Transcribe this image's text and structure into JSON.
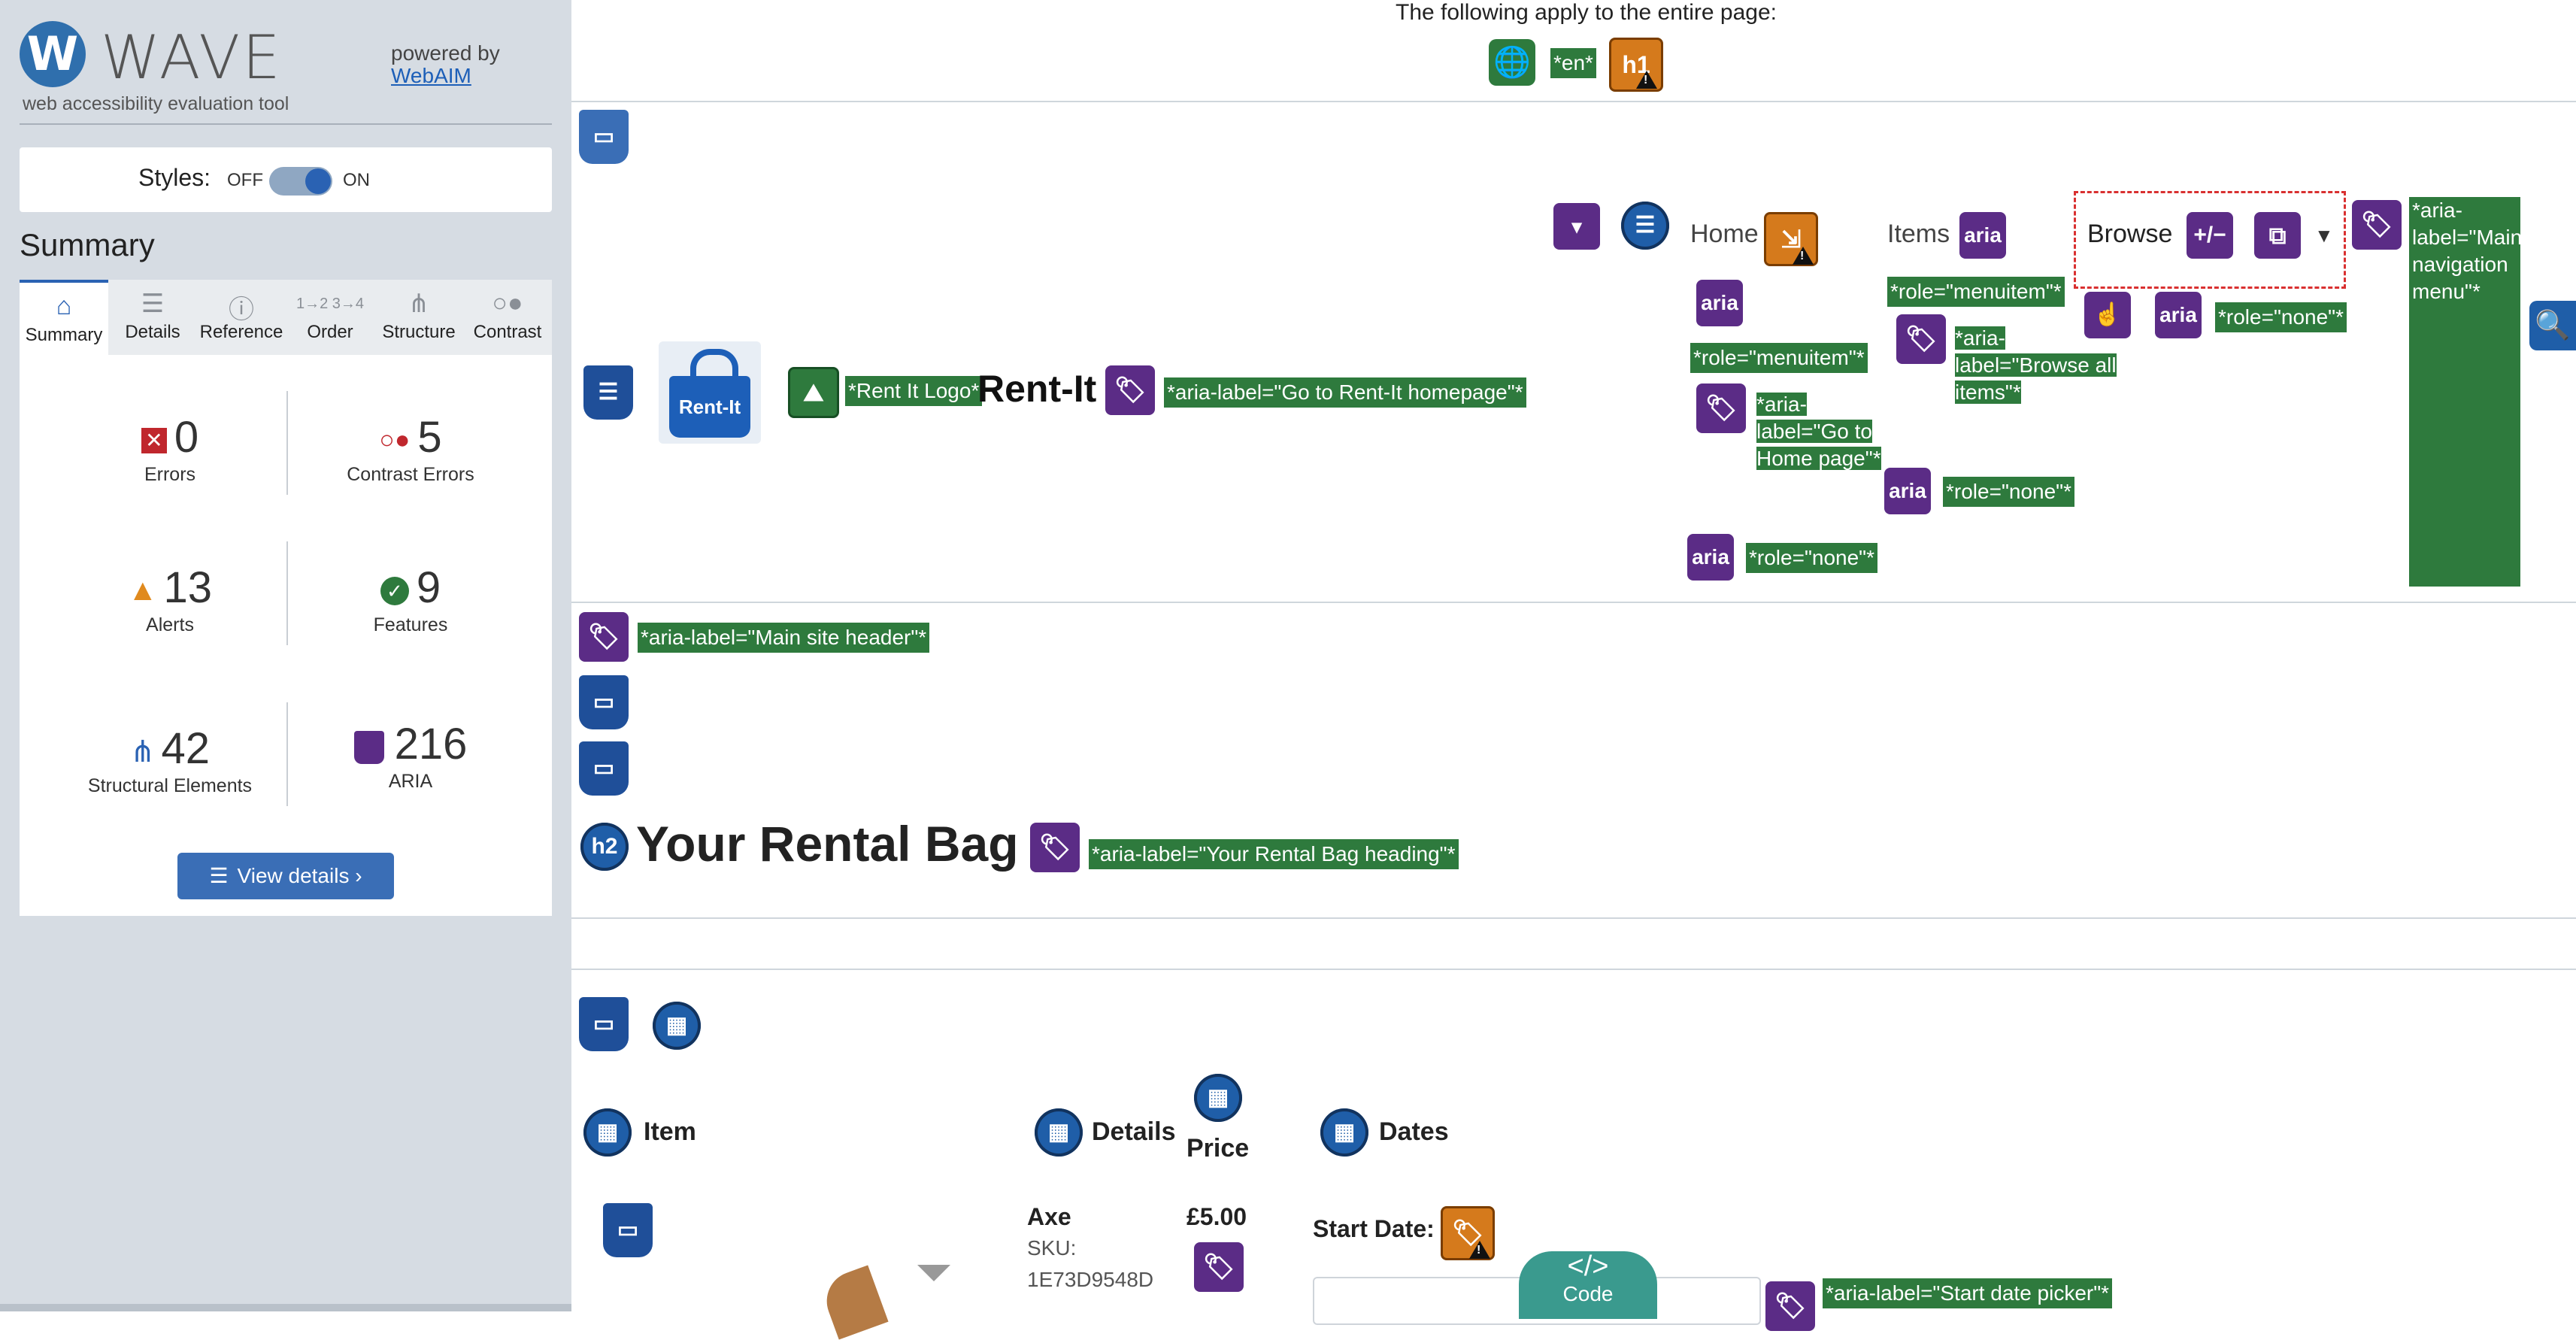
{
  "wave": {
    "brand": "WAVE",
    "tagline": "web accessibility evaluation tool",
    "powered_by": "powered by",
    "webaim": "WebAIM",
    "styles_label": "Styles:",
    "styles_off": "OFF",
    "styles_on": "ON",
    "summary_title": "Summary",
    "tabs": [
      {
        "label": "Summary",
        "icon": "house-icon"
      },
      {
        "label": "Details",
        "icon": "list-icon"
      },
      {
        "label": "Reference",
        "icon": "info-icon"
      },
      {
        "label": "Order",
        "icon": "order-icon"
      },
      {
        "label": "Structure",
        "icon": "hierarchy-icon"
      },
      {
        "label": "Contrast",
        "icon": "contrast-icon"
      }
    ],
    "stats": {
      "errors": {
        "value": "0",
        "label": "Errors"
      },
      "contrast": {
        "value": "5",
        "label": "Contrast Errors"
      },
      "alerts": {
        "value": "13",
        "label": "Alerts"
      },
      "features": {
        "value": "9",
        "label": "Features"
      },
      "structural": {
        "value": "42",
        "label": "Structural Elements"
      },
      "aria": {
        "value": "216",
        "label": "ARIA"
      }
    },
    "view_details": "View details ›",
    "colors": {
      "accent": "#2a62b3",
      "error": "#c0272d",
      "alert": "#e08a1e",
      "feature": "#2e7a3d",
      "aria": "#5b2c86"
    }
  },
  "page": {
    "top_notice": "The following apply to the entire page:",
    "lang_label": "*en*",
    "h1_label": "h1",
    "logo_text": "Rent-It",
    "logo_alt": "*Rent It Logo*",
    "site_name": "Rent-It",
    "aria_home_link": "*aria-label=\"Go to Rent-It homepage\"*",
    "nav": {
      "home": "Home",
      "items": "Items",
      "browse": "Browse",
      "aria": "aria",
      "plusminus": "+/−",
      "role_menuitem": "*role=\"menuitem\"*",
      "aria_go_home": "*aria-label=\"Go to Home page\"*",
      "aria_browse_all": "*aria-label=\"Browse all items\"*",
      "role_none": "*role=\"none\"*",
      "aria_main_nav": "*aria-label=\"Main navigation menu\"*"
    },
    "aria_site_header": "*aria-label=\"Main site header\"*",
    "h2_label": "h2",
    "heading": "Your Rental Bag",
    "aria_heading": "*aria-label=\"Your Rental Bag heading\"*",
    "table": {
      "col_item": "Item",
      "col_details": "Details",
      "col_price": "Price",
      "col_dates": "Dates"
    },
    "row": {
      "name": "Axe",
      "sku_label": "SKU:",
      "sku": "1E73D9548D",
      "price": "£5.00",
      "start_date": "Start Date:",
      "aria_start_picker": "*aria-label=\"Start date picker\"*"
    },
    "code_button": "Code"
  }
}
